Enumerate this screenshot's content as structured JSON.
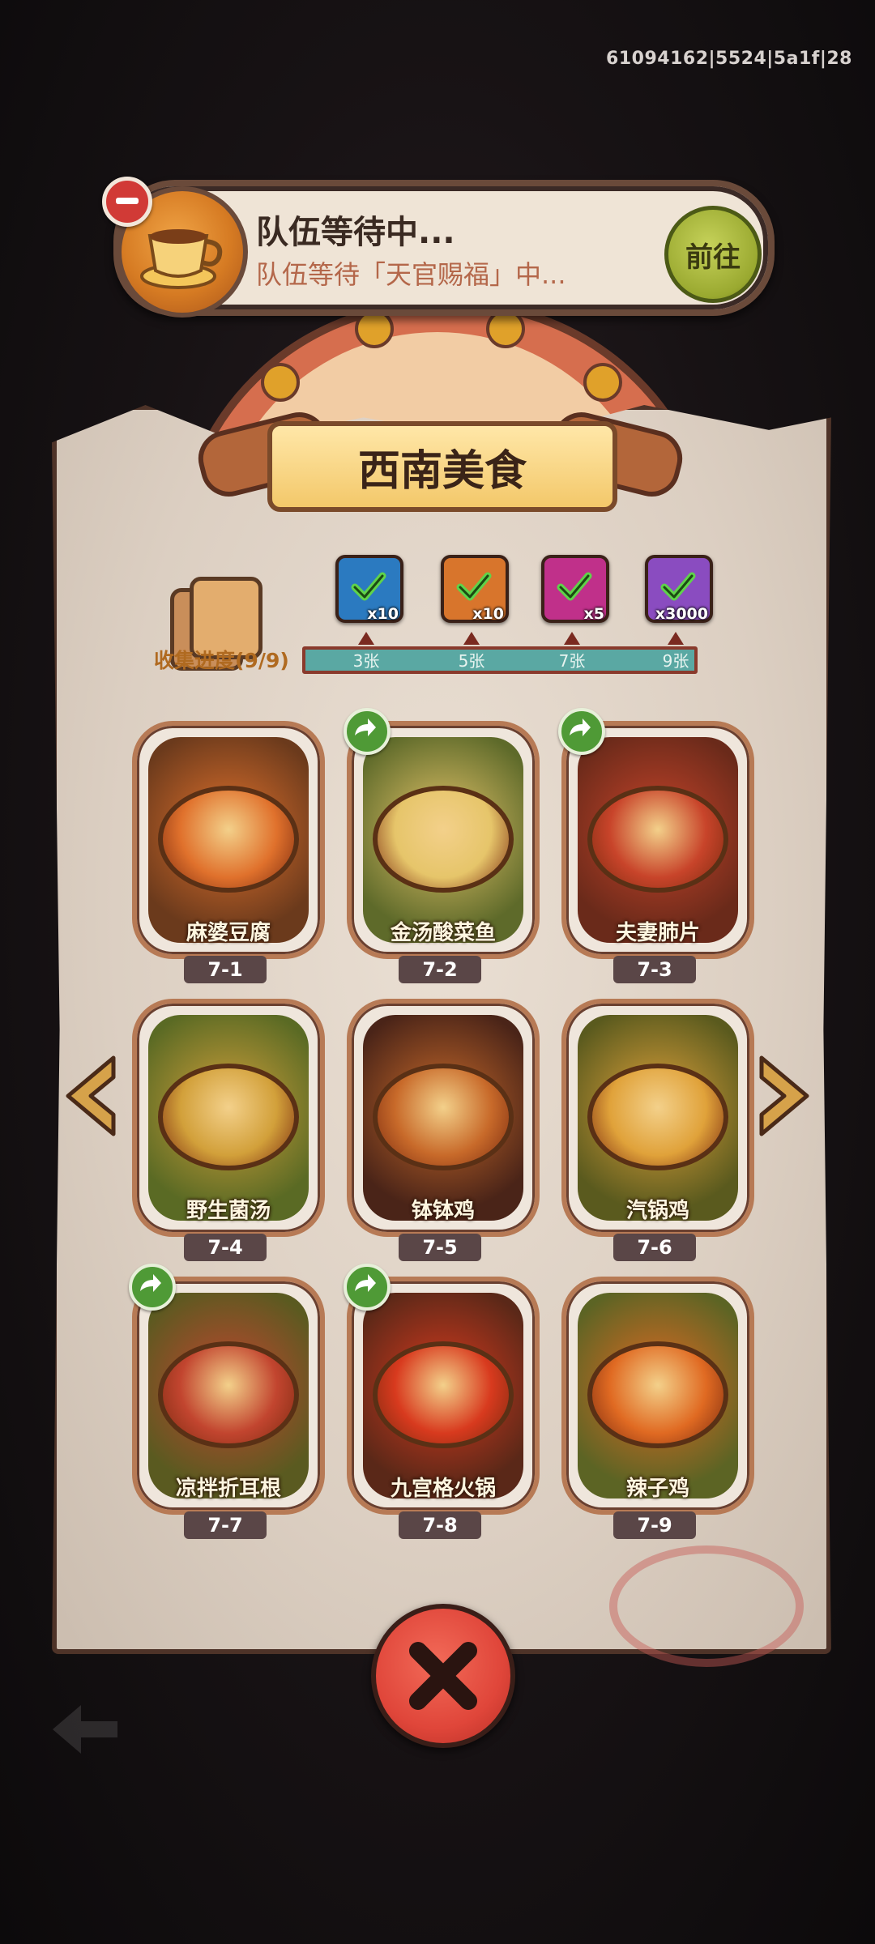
{
  "debug_id": "61094162|5524|5a1f|28",
  "team_banner": {
    "title": "队伍等待中...",
    "subtitle": "队伍等待「天官赐福」中...",
    "go_label": "前往"
  },
  "panel_title": "西南美食",
  "collection": {
    "label": "收集进度(9/9)",
    "progress": 1.0,
    "tiers": [
      {
        "threshold_label": "3张",
        "reward_count": "x10",
        "color": "#2b7ac0",
        "claimed": true
      },
      {
        "threshold_label": "5张",
        "reward_count": "x10",
        "color": "#d8752c",
        "claimed": true
      },
      {
        "threshold_label": "7张",
        "reward_count": "x5",
        "color": "#c0308a",
        "claimed": true
      },
      {
        "threshold_label": "9张",
        "reward_count": "x3000",
        "color": "#8a4cc0",
        "claimed": true
      }
    ]
  },
  "dishes": [
    {
      "name": "麻婆豆腐",
      "level": "7-1",
      "share": false,
      "bg": "#6b3a1c",
      "food": "#e0712c"
    },
    {
      "name": "金汤酸菜鱼",
      "level": "7-2",
      "share": true,
      "bg": "#5e6a2a",
      "food": "#e6c56a"
    },
    {
      "name": "夫妻肺片",
      "level": "7-3",
      "share": true,
      "bg": "#6a2a1a",
      "food": "#c8442a"
    },
    {
      "name": "野生菌汤",
      "level": "7-4",
      "share": false,
      "bg": "#5a6a24",
      "food": "#d2a03a"
    },
    {
      "name": "钵钵鸡",
      "level": "7-5",
      "share": false,
      "bg": "#4a2418",
      "food": "#c86a2a"
    },
    {
      "name": "汽锅鸡",
      "level": "7-6",
      "share": false,
      "bg": "#5a5a1e",
      "food": "#e0a23a"
    },
    {
      "name": "凉拌折耳根",
      "level": "7-7",
      "share": true,
      "bg": "#5a5a20",
      "food": "#c2452f"
    },
    {
      "name": "九宫格火锅",
      "level": "7-8",
      "share": true,
      "bg": "#5a2818",
      "food": "#d83a1e"
    },
    {
      "name": "辣子鸡",
      "level": "7-9",
      "share": false,
      "bg": "#5c6424",
      "food": "#e06a22"
    }
  ],
  "colors": {
    "accent_green": "#4f9a36",
    "close_red": "#e0463a",
    "panel": "#dccfc2"
  }
}
